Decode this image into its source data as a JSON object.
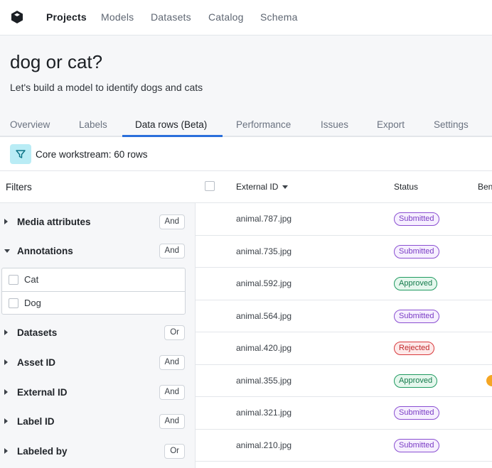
{
  "nav": {
    "items": [
      "Projects",
      "Models",
      "Datasets",
      "Catalog",
      "Schema"
    ],
    "active": "Projects"
  },
  "project": {
    "title": "dog or cat?",
    "description": "Let's build a model to identify dogs and cats"
  },
  "tabs": [
    "Overview",
    "Labels",
    "Data rows (Beta)",
    "Performance",
    "Issues",
    "Export",
    "Settings"
  ],
  "active_tab": "Data rows (Beta)",
  "workstream": {
    "text": "Core workstream: 60 rows"
  },
  "filters": {
    "title": "Filters",
    "groups": [
      {
        "label": "Media attributes",
        "op": "And"
      },
      {
        "label": "Annotations",
        "op": "And",
        "expanded": true,
        "options": [
          "Cat",
          "Dog"
        ]
      },
      {
        "label": "Datasets",
        "op": "Or"
      },
      {
        "label": "Asset ID",
        "op": "And"
      },
      {
        "label": "External ID",
        "op": "And"
      },
      {
        "label": "Label ID",
        "op": "And"
      },
      {
        "label": "Labeled by",
        "op": "Or"
      }
    ]
  },
  "table": {
    "columns": [
      "External ID",
      "Status",
      "Ben"
    ],
    "rows": [
      {
        "external_id": "animal.787.jpg",
        "status": "Submitted"
      },
      {
        "external_id": "animal.735.jpg",
        "status": "Submitted"
      },
      {
        "external_id": "animal.592.jpg",
        "status": "Approved"
      },
      {
        "external_id": "animal.564.jpg",
        "status": "Submitted"
      },
      {
        "external_id": "animal.420.jpg",
        "status": "Rejected"
      },
      {
        "external_id": "animal.355.jpg",
        "status": "Approved",
        "benchmark": true
      },
      {
        "external_id": "animal.321.jpg",
        "status": "Submitted"
      },
      {
        "external_id": "animal.210.jpg",
        "status": "Submitted"
      }
    ]
  },
  "colors": {
    "accent": "#2a6fdb",
    "filter_button": "#b9ecf5",
    "submitted": "#8a4fd1",
    "approved": "#1f9a60",
    "rejected": "#d8393c",
    "benchmark": "#f5a623"
  }
}
